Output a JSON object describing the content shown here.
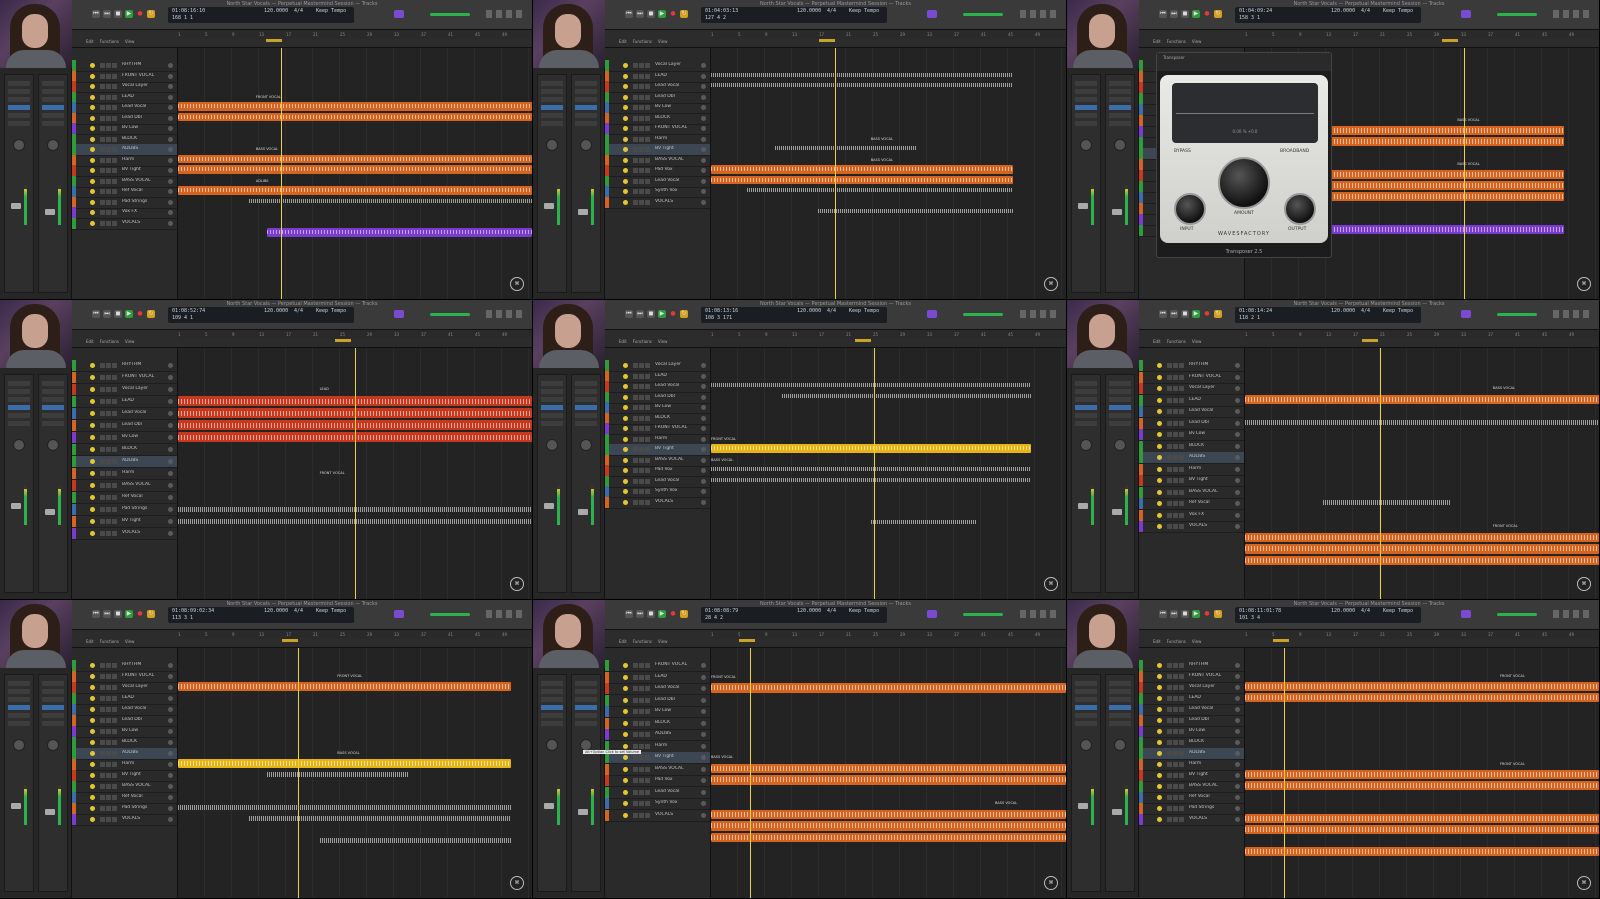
{
  "window_title": "North Star Vocals — Perpetual Mastermind Session — Tracks",
  "colors": {
    "accent_orange": "#d4641f",
    "accent_yellow": "#e6b415",
    "play_green": "#2f9c3c",
    "playhead": "#e6d34a"
  },
  "menus": [
    "Edit",
    "Functions",
    "View"
  ],
  "ruler_ticks": [
    "1",
    "5",
    "9",
    "13",
    "17",
    "21",
    "25",
    "29",
    "33",
    "37",
    "41",
    "45",
    "49"
  ],
  "panels": [
    {
      "lcd": {
        "time": "01:08:16:10",
        "bars": "168  1  1",
        "tempo": "120.0000",
        "sig": "4/4",
        "key": "Keep Tempo",
        "key2": "No In"
      },
      "tracks": [
        "RHYTHM",
        "FRONT VOCAL",
        "Vocal Layer",
        "LEAD",
        "Lead Vocal",
        "Lead Dbl",
        "Bv Low",
        "BLOCK",
        "ADLIBS",
        "Harm",
        "BV Tight",
        "BASS VOCAL",
        "Ref Vocal",
        "Pad Strings",
        "Vox FX",
        "VOCALS"
      ],
      "markers": [
        "FRONT VOCAL",
        "BASS VOCAL",
        "ADLIBS"
      ]
    },
    {
      "lcd": {
        "time": "01:04:03:13",
        "bars": "127  4  2",
        "tempo": "120.0000",
        "sig": "4/4",
        "key": "Keep Tempo",
        "key2": "No Out"
      },
      "tracks": [
        "Vocal Layer",
        "LEAD",
        "Lead Vocal",
        "Lead Dbl",
        "Bv Low",
        "BLOCK",
        "FRONT VOCAL",
        "Harm",
        "BV Tight",
        "BASS VOCAL",
        "Pad Vox",
        "Lead Vocal",
        "Synth Vox",
        "VOCALS"
      ],
      "markers": [
        "BASS VOCAL",
        "BASS VOCAL"
      ]
    },
    {
      "lcd": {
        "time": "01:04:09:24",
        "bars": "158  3  1",
        "tempo": "120.0000",
        "sig": "4/4",
        "key": "Keep Tempo",
        "key2": "No Out"
      },
      "tracks": [
        "RHYTHM",
        "FRONT VOCAL",
        "Vocal Layer",
        "LEAD",
        "Lead Vocal",
        "Lead Dbl",
        "Bv Low",
        "BLOCK",
        "ADLIBS",
        "Harm",
        "BV Tight",
        "BASS VOCAL",
        "Ref Vocal",
        "Pad Strings",
        "Vox FX",
        "VOCALS"
      ],
      "markers": [
        "BASS VOCAL",
        "BASS VOCAL"
      ],
      "plugin": {
        "title": "Transposer",
        "brand": "WAVESFACTORY",
        "name": "Transposer 2.5",
        "mode": "BROADBAND",
        "bypass": "BYPASS",
        "amount": "AMOUNT",
        "input": "INPUT",
        "output": "OUTPUT",
        "readout": "0.00 % +0.0"
      }
    },
    {
      "lcd": {
        "time": "01:08:52:74",
        "bars": "109  4  1",
        "tempo": "120.0000",
        "sig": "4/4",
        "key": "Keep Tempo",
        "key2": "No Out"
      },
      "tracks": [
        "RHYTHM",
        "FRONT VOCAL",
        "Vocal Layer",
        "LEAD",
        "Lead Vocal",
        "Lead Dbl",
        "Bv Low",
        "BLOCK",
        "ADLIBS",
        "Harm",
        "BASS VOCAL",
        "Ref Vocal",
        "Pad Strings",
        "BV Tight",
        "VOCALS"
      ],
      "markers": [
        "LEAD",
        "FRONT VOCAL"
      ]
    },
    {
      "lcd": {
        "time": "01:08:13:16",
        "bars": "108  3  171",
        "tempo": "120.0000",
        "sig": "4/4",
        "key": "Keep Tempo",
        "key2": "No Out"
      },
      "tracks": [
        "Vocal Layer",
        "LEAD",
        "Lead Vocal",
        "Lead Dbl",
        "Bv Low",
        "BLOCK",
        "FRONT VOCAL",
        "Harm",
        "BV Tight",
        "BASS VOCAL",
        "Pad Vox",
        "Lead Vocal",
        "Synth Vox",
        "VOCALS"
      ],
      "markers": [
        "FRONT VOCAL",
        "BASS VOCAL"
      ]
    },
    {
      "lcd": {
        "time": "01:08:14:24",
        "bars": "118  2  1",
        "tempo": "120.0000",
        "sig": "4/4",
        "key": "Keep Tempo",
        "key2": "No Out"
      },
      "tracks": [
        "RHYTHM",
        "FRONT VOCAL",
        "Vocal Layer",
        "LEAD",
        "Lead Vocal",
        "Lead Dbl",
        "Bv Low",
        "BLOCK",
        "ADLIBS",
        "Harm",
        "BV Tight",
        "BASS VOCAL",
        "Ref Vocal",
        "Vox FX",
        "VOCALS"
      ],
      "markers": [
        "BASS VOCAL",
        "FRONT VOCAL"
      ]
    },
    {
      "lcd": {
        "time": "01:08:09:02:34",
        "bars": "113  3  1",
        "tempo": "120.0000",
        "sig": "4/4",
        "key": "Keep Tempo",
        "key2": "No Out"
      },
      "tracks": [
        "RHYTHM",
        "FRONT VOCAL",
        "Vocal Layer",
        "LEAD",
        "Lead Vocal",
        "Lead Dbl",
        "Bv Low",
        "BLOCK",
        "ADLIBS",
        "Harm",
        "BV Tight",
        "BASS VOCAL",
        "Ref Vocal",
        "Pad Strings",
        "VOCALS"
      ],
      "markers": [
        "FRONT VOCAL",
        "BASS VOCAL"
      ]
    },
    {
      "lcd": {
        "time": "01:08:08:79",
        "bars": "28  4  2",
        "tempo": "120.0000",
        "sig": "4/4",
        "key": "Keep Tempo",
        "key2": "No Out"
      },
      "tracks": [
        "FRONT VOCAL",
        "LEAD",
        "Lead Vocal",
        "Lead Dbl",
        "Bv Low",
        "BLOCK",
        "ADLIBS",
        "Harm",
        "BV Tight",
        "BASS VOCAL",
        "Pad Vox",
        "Lead Vocal",
        "Synth Vox",
        "VOCALS"
      ],
      "markers": [
        "FRONT VOCAL",
        "BASS VOCAL",
        "BASS VOCAL"
      ],
      "tooltip": "Alt+Option Click to set Volume"
    },
    {
      "lcd": {
        "time": "01:08:11:01:78",
        "bars": "101  3  4",
        "tempo": "120.0000",
        "sig": "4/4",
        "key": "Keep Tempo",
        "key2": "No Out"
      },
      "tracks": [
        "RHYTHM",
        "FRONT VOCAL",
        "Vocal Layer",
        "LEAD",
        "Lead Vocal",
        "Lead Dbl",
        "Bv Low",
        "BLOCK",
        "ADLIBS",
        "Harm",
        "BV Tight",
        "BASS VOCAL",
        "Ref Vocal",
        "Pad Strings",
        "VOCALS"
      ],
      "markers": [
        "FRONT VOCAL",
        "FRONT VOCAL"
      ]
    }
  ]
}
